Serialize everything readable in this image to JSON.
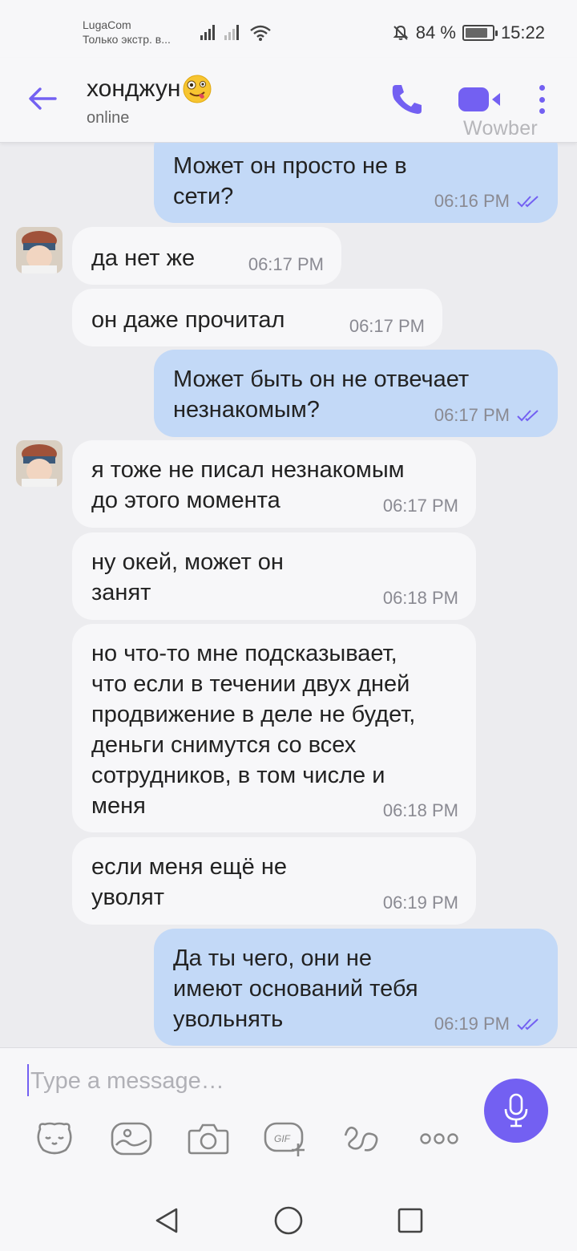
{
  "status_bar": {
    "carrier": "LugaCom",
    "network_note": "Только экстр. в...",
    "battery": "84 %",
    "battery_level": 0.84,
    "time": "15:22"
  },
  "header": {
    "contact_name": "хонджун",
    "contact_emoji": "zany-face",
    "status": "online",
    "watermark": "Wowber"
  },
  "messages": [
    {
      "dir": "out",
      "text": "Может он просто не в\nсети?",
      "time": "06:16 PM"
    },
    {
      "dir": "in",
      "text": "да нет же",
      "time": "06:17 PM",
      "avatar": true
    },
    {
      "dir": "in",
      "text": "он даже прочитал",
      "time": "06:17 PM"
    },
    {
      "dir": "out",
      "text": "Может быть он не отвечает\nнезнакомым?",
      "time": "06:17 PM"
    },
    {
      "dir": "in",
      "text": "я тоже не писал незнакомым\nдо этого момента",
      "time": "06:17 PM",
      "avatar": true
    },
    {
      "dir": "in",
      "text": "ну окей, может он\nзанят",
      "time": "06:18 PM"
    },
    {
      "dir": "in",
      "text": "но что-то мне подсказывает,\nчто если в течении двух дней\nпродвижение в деле не будет,\nденьги снимутся со всех\nсотрудников, в том числе и\nменя",
      "time": "06:18 PM"
    },
    {
      "dir": "in",
      "text": "если меня ещё не\nуволят",
      "time": "06:19 PM"
    },
    {
      "dir": "out",
      "text": "Да ты чего, они не\nимеют оснований тебя\nувольнять",
      "time": "06:19 PM"
    }
  ],
  "composer": {
    "placeholder": "Type a message…",
    "value": ""
  },
  "toolbar_icons": [
    "sticker-icon",
    "gallery-icon",
    "camera-icon",
    "gif-icon",
    "doodle-icon",
    "more-options-icon"
  ],
  "colors": {
    "accent": "#7360f2",
    "outgoing_bubble": "#c3d9f7",
    "incoming_bubble": "#f7f7f9",
    "background": "#ececef"
  }
}
